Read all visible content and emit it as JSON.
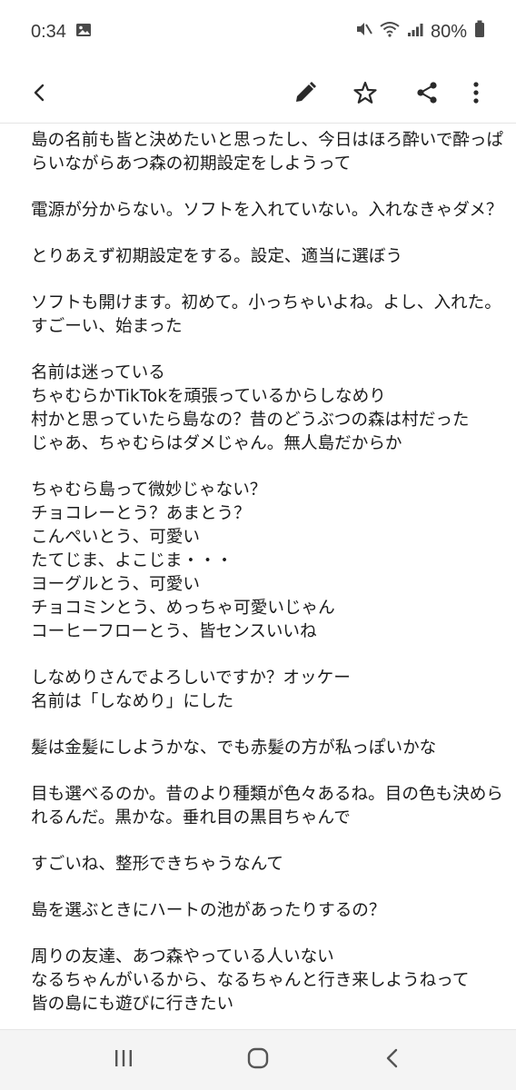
{
  "status_bar": {
    "time": "0:34",
    "battery": "80%",
    "icons": [
      "image-notification-icon",
      "mute-icon",
      "wifi-icon",
      "signal-icon",
      "battery-icon"
    ]
  },
  "toolbar": {
    "icons": [
      "back-icon",
      "pencil-icon",
      "star-icon",
      "share-icon",
      "more-vert-icon"
    ]
  },
  "note": {
    "paragraphs": [
      [
        "島の名前も皆と決めたいと思ったし、今日はほろ酔いで酔っぱ",
        "らいながらあつ森の初期設定をしようって"
      ],
      [
        "電源が分からない。ソフトを入れていない。入れなきゃダメ？"
      ],
      [
        "とりあえず初期設定をする。設定、適当に選ぼう"
      ],
      [
        "ソフトも開けます。初めて。小っちゃいよね。よし、入れた。",
        "すごーい、始まった"
      ],
      [
        "名前は迷っている",
        "ちゃむらかTikTokを頑張っているからしなめり",
        "村かと思っていたら島なの？昔のどうぶつの森は村だった",
        "じゃあ、ちゃむらはダメじゃん。無人島だからか"
      ],
      [
        "ちゃむら島って微妙じゃない？",
        "チョコレーとう？あまとう？",
        "こんぺいとう、可愛い",
        "たてじま、よこじま・・・",
        "ヨーグルとう、可愛い",
        "チョコミンとう、めっちゃ可愛いじゃん",
        "コーヒーフローとう、皆センスいいね"
      ],
      [
        "しなめりさんでよろしいですか？オッケー",
        "名前は「しなめり」にした"
      ],
      [
        "髪は金髪にしようかな、でも赤髪の方が私っぽいかな"
      ],
      [
        "目も選べるのか。昔のより種類が色々あるね。目の色も決めら",
        "れるんだ。黒かな。垂れ目の黒目ちゃんで"
      ],
      [
        "すごいね、整形できちゃうなんて"
      ],
      [
        "島を選ぶときにハートの池があったりするの？"
      ],
      [
        "周りの友達、あつ森やっている人いない",
        "なるちゃんがいるから、なるちゃんと行き来しようねって",
        "皆の島にも遊びに行きたい"
      ]
    ]
  },
  "nav_bar": {
    "icons": [
      "recent-apps-icon",
      "home-icon",
      "back-icon"
    ]
  },
  "colors": {
    "text": "#1b1b1b",
    "icon": "#2a2a2a",
    "nav_background": "#f4f4f4"
  }
}
